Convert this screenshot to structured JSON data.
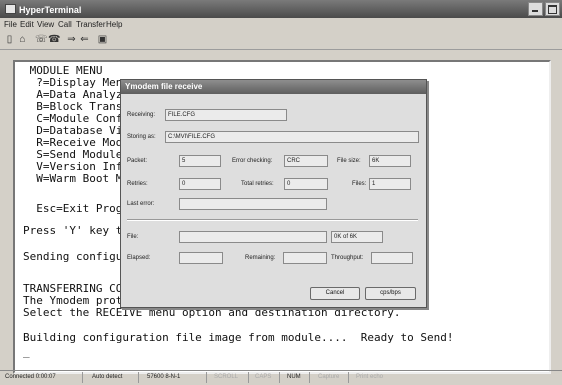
{
  "window": {
    "title": "HyperTerminal"
  },
  "menu": [
    "File",
    "Edit",
    "View",
    "Call",
    "Transfer",
    "Help"
  ],
  "toolbar": [
    {
      "name": "new-icon",
      "glyph": "▯"
    },
    {
      "name": "open-folder-icon",
      "glyph": "⌂"
    },
    {
      "name": "phone-icon",
      "glyph": "☏"
    },
    {
      "name": "hangup-icon",
      "glyph": "☎"
    },
    {
      "name": "send-icon",
      "glyph": "⇒"
    },
    {
      "name": "receive-icon",
      "glyph": "⇐"
    },
    {
      "name": "properties-icon",
      "glyph": "▣"
    }
  ],
  "terminal": {
    "lines": [
      " MODULE MENU",
      "  ?=Display Menu",
      "  A=Data Analyzer",
      "  B=Block Transfer",
      "  C=Module Config",
      "  D=Database View",
      "  R=Receive Modul",
      "  S=Send Module C",
      "  V=Version Infor",
      "  W=Warm Boot Mod",
      "",
      "  Esc=Exit Progra",
      "",
      "Press 'Y' key to",
      "",
      "Sending configura",
      "",
      "",
      "TRANSFERRING CONF",
      "The Ymodem protoc",
      "Select the RECEIVE menu option and destination directory.",
      "",
      "Building configuration file image from module....  Ready to Send!",
      "_"
    ]
  },
  "dialog": {
    "title": "Ymodem file receive",
    "receiving_label": "Receiving:",
    "receiving_value": "FILE.CFG",
    "storing_label": "Storing as:",
    "storing_value": "C:\\MVI\\FILE.CFG",
    "packet_label": "Packet:",
    "packet_value": "5",
    "error_checking_label": "Error checking:",
    "error_checking_value": "CRC",
    "file_size_label": "File size:",
    "file_size_value": "6K",
    "retries_label": "Retries:",
    "retries_value": "0",
    "total_retries_label": "Total retries:",
    "total_retries_value": "0",
    "files_label": "Files:",
    "files_value": "1",
    "last_error_label": "Last error:",
    "last_error_value": "",
    "file_label": "File:",
    "file_progress_text": "0K of 6K",
    "elapsed_label": "Elapsed:",
    "elapsed_value": "",
    "remaining_label": "Remaining:",
    "remaining_value": "",
    "throughput_label": "Throughput:",
    "throughput_value": "",
    "cancel_label": "Cancel",
    "cps_label": "cps/bps"
  },
  "status": {
    "connected": "Connected 0:00:07",
    "detect": "Auto detect",
    "baud": "57600 8-N-1",
    "scroll": "SCROLL",
    "caps": "CAPS",
    "num": "NUM",
    "capture": "Capture",
    "print": "Print echo"
  }
}
